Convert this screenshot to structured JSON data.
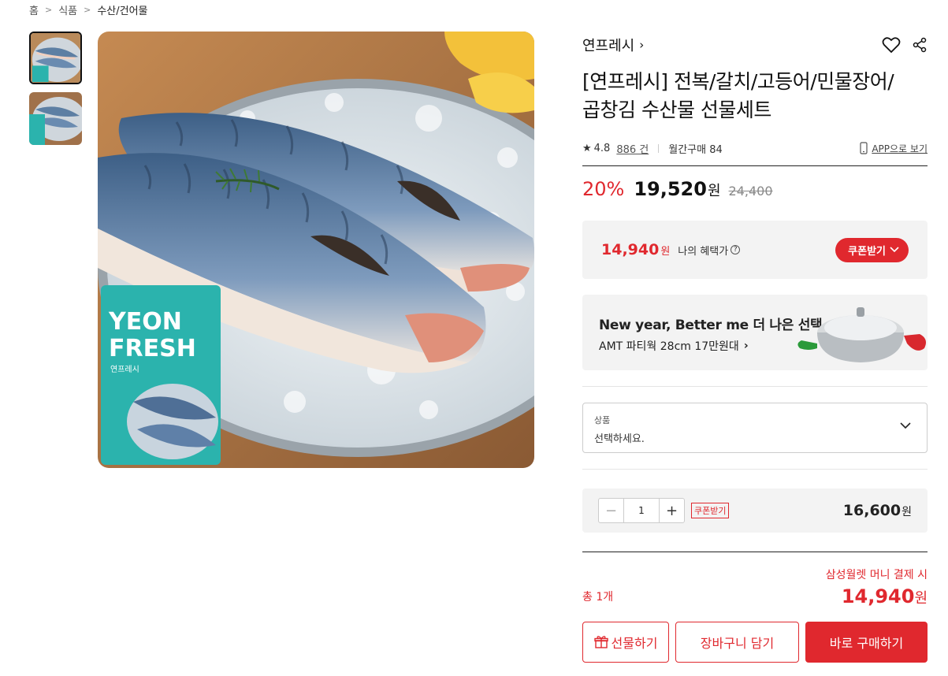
{
  "breadcrumb": {
    "home": "홈",
    "category": "식품",
    "subcategory": "수산/건어물"
  },
  "product": {
    "brand": "연프레시",
    "title_line1": "[연프레시] 전복/갈치/고등어/민물장어/",
    "title_line2": "곱창김 수산물 선물세트",
    "rating": "4.8",
    "reviews": "886 건",
    "monthly_sales": "월간구매 84",
    "app_view": "APP으로 보기",
    "discount": "20%",
    "sale_price": "19,520",
    "won": "원",
    "original_price": "24,400"
  },
  "image": {
    "pack_line1": "YEON",
    "pack_line2": "FRESH",
    "pack_brand": "연프레시"
  },
  "benefit": {
    "price": "14,940",
    "won": "원",
    "label": "나의 혜택가",
    "help": "?",
    "coupon_button": "쿠폰받기"
  },
  "banner": {
    "title": "New year, Better me 더 나은 선택",
    "subtitle": "AMT 파티웍 28cm 17만원대"
  },
  "option_select": {
    "label": "상품",
    "placeholder": "선택하세요."
  },
  "quantity": {
    "minus": "−",
    "value": "1",
    "plus": "+",
    "coupon_tag": "쿠폰받기",
    "price": "16,600",
    "won": "원"
  },
  "total": {
    "count": "총 1개",
    "note": "삼성월렛 머니 결제 시",
    "amount": "14,940",
    "won": "원"
  },
  "actions": {
    "gift": "선물하기",
    "cart": "장바구니 담기",
    "buy": "바로 구매하기"
  },
  "colors": {
    "accent": "#e0282e",
    "panel": "#f3f3f3"
  }
}
